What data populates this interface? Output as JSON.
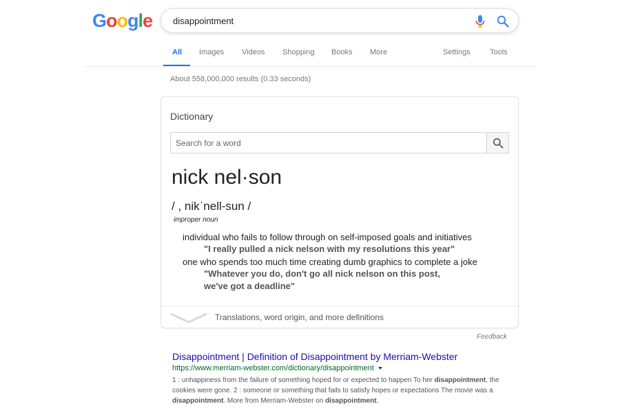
{
  "logo": {
    "letters": [
      "G",
      "o",
      "o",
      "g",
      "l",
      "e"
    ],
    "colors": [
      "#4285F4",
      "#EA4335",
      "#FBBC05",
      "#4285F4",
      "#34A853",
      "#EA4335"
    ]
  },
  "search": {
    "query": "disappointment"
  },
  "tabs": {
    "items": [
      {
        "label": "All",
        "active": true
      },
      {
        "label": "Images"
      },
      {
        "label": "Videos"
      },
      {
        "label": "Shopping"
      },
      {
        "label": "Books"
      },
      {
        "label": "More"
      }
    ],
    "settings": "Settings",
    "tools": "Tools"
  },
  "result_stats": "About 558,000,000 results (0.33 seconds)",
  "dictionary": {
    "title": "Dictionary",
    "search_placeholder": "Search for a word",
    "word": "nick nel·son",
    "phonetic": "/ , nikˈnell-sun /",
    "part_of_speech": "improper noun",
    "definitions": [
      {
        "text": "individual who fails to follow through on self-imposed goals and initiatives",
        "example": [
          "\"I really pulled a nick nelson with my resolutions this year\""
        ]
      },
      {
        "text": "one who spends too much time creating dumb graphics to complete a joke",
        "example": [
          "\"Whatever you do, don't go all nick nelson on this post,",
          "we've got a deadline\""
        ]
      }
    ],
    "more_link": "Translations, word origin, and more definitions"
  },
  "feedback": "Feedback",
  "result": {
    "title": "Disappointment | Definition of Disappointment by Merriam-Webster",
    "url": "https://www.merriam-webster.com/dictionary/disappointment",
    "snippet": [
      {
        "t": "1 : unhappiness from the failure of something hoped for or expected to happen To her "
      },
      {
        "t": "disappointment",
        "b": true
      },
      {
        "t": ", the cookies were gone. 2 : someone or something that fails to satisfy hopes or expectations The movie was a "
      },
      {
        "t": "disappointment",
        "b": true
      },
      {
        "t": ". More from Merriam-Webster on "
      },
      {
        "t": "disappointment",
        "b": true
      },
      {
        "t": "."
      }
    ]
  },
  "colors": {
    "link": "#1a0dab",
    "url": "#006621",
    "accent": "#1a73e8"
  }
}
